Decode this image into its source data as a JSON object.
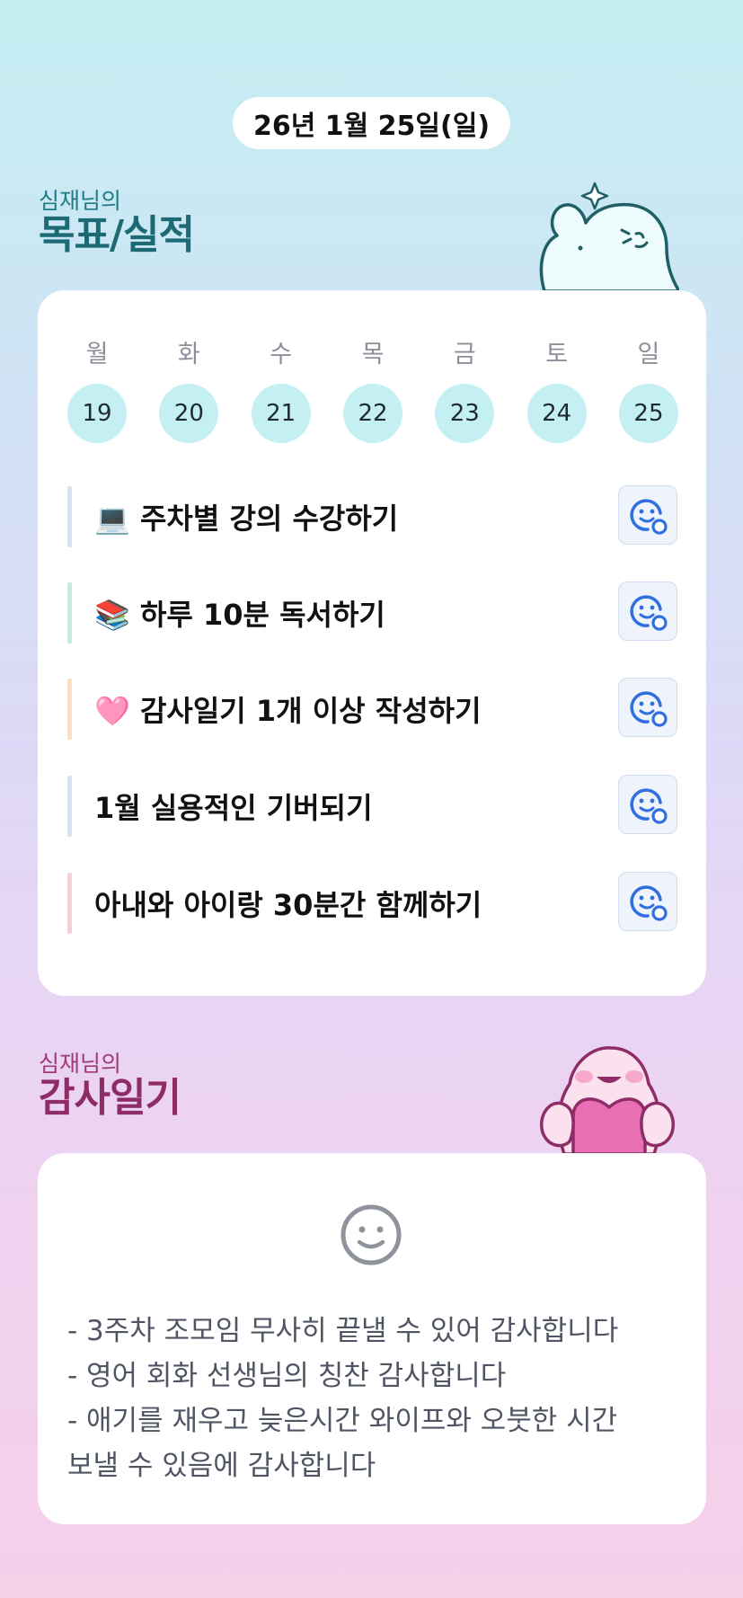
{
  "header": {
    "date": "26년 1월 25일(일)"
  },
  "goals_section": {
    "owner": "심재님의",
    "title": "목표/실적"
  },
  "week": {
    "days": [
      {
        "name": "월",
        "num": "19"
      },
      {
        "name": "화",
        "num": "20"
      },
      {
        "name": "수",
        "num": "21"
      },
      {
        "name": "목",
        "num": "22"
      },
      {
        "name": "금",
        "num": "23"
      },
      {
        "name": "토",
        "num": "24"
      },
      {
        "name": "일",
        "num": "25"
      }
    ]
  },
  "goals": [
    {
      "text": "💻 주차별 강의 수강하기",
      "bar_color": "#d7e2f6"
    },
    {
      "text": "📚 하루 10분 독서하기",
      "bar_color": "#bfeede"
    },
    {
      "text": "🩷 감사일기 1개 이상 작성하기",
      "bar_color": "#fde0bd"
    },
    {
      "text": "1월 실용적인 기버되기",
      "bar_color": "#d7e2f6"
    },
    {
      "text": "아내와 아이랑 30분간 함께하기",
      "bar_color": "#f8cfd3"
    }
  ],
  "thanks_section": {
    "owner": "심재님의",
    "title": "감사일기"
  },
  "thanks": {
    "lines": [
      "- 3주차 조모임 무사히 끝낼 수 있어 감사합니다",
      "- 영어 회화 선생님의 칭찬 감사합니다",
      "- 애기를 재우고 늦은시간 와이프와 오붓한 시간",
      "보낼 수 있음에 감사합니다"
    ]
  },
  "colors": {
    "accent_blue": "#2f6fe0",
    "goals_title": "#1c6a74",
    "thanks_title": "#8d2c67",
    "day_circle": "#c5f0f3"
  },
  "icons": {
    "goal_status": "smiley-plus-icon",
    "thanks_mood": "smiley-face-icon",
    "goals_mascot": "cheering-ghost-mascot",
    "thanks_mascot": "heart-hug-mascot"
  }
}
